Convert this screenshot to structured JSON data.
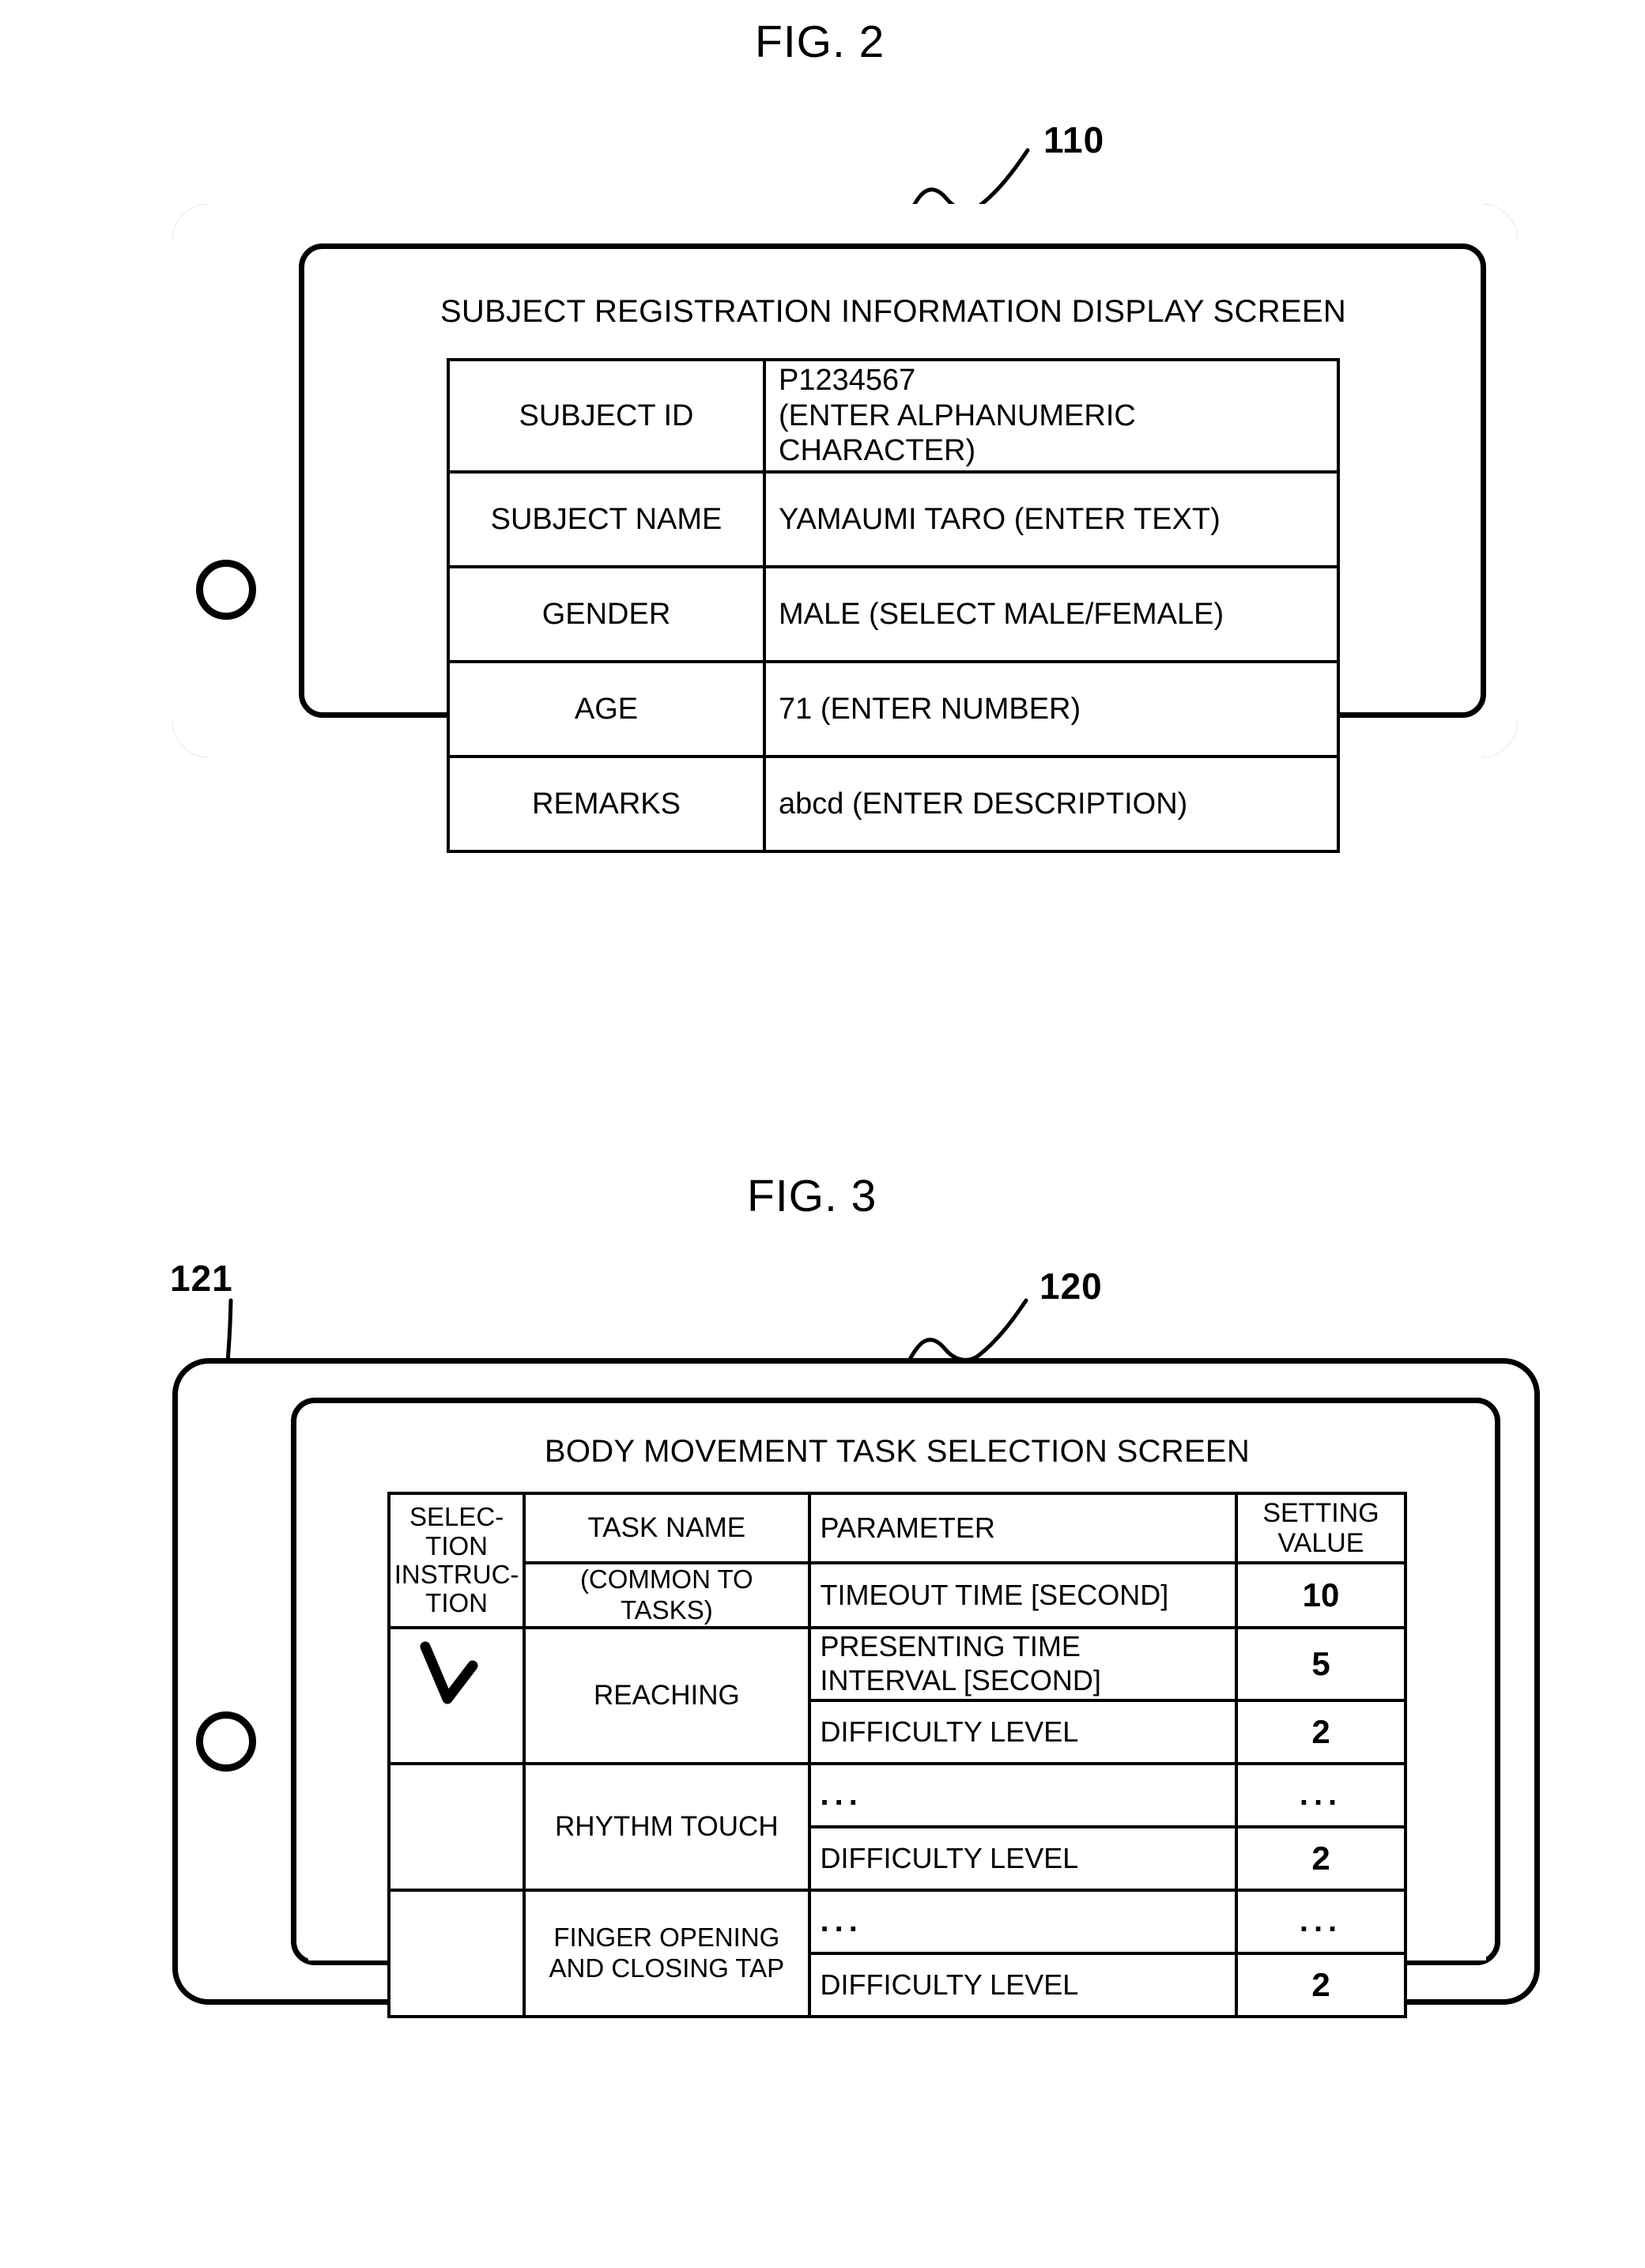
{
  "figures": [
    {
      "fig_label": "FIG. 2",
      "reference_numeral": "110",
      "screen_title": "SUBJECT REGISTRATION INFORMATION DISPLAY SCREEN",
      "table": {
        "rows": [
          {
            "label": "SUBJECT ID",
            "value_line1": "P1234567",
            "value_line2": "(ENTER ALPHANUMERIC CHARACTER)"
          },
          {
            "label": "SUBJECT NAME",
            "value_line1": "YAMAUMI TARO (ENTER TEXT)",
            "value_line2": ""
          },
          {
            "label": "GENDER",
            "value_line1": "MALE (SELECT MALE/FEMALE)",
            "value_line2": ""
          },
          {
            "label": "AGE",
            "value_line1": "71 (ENTER NUMBER)",
            "value_line2": ""
          },
          {
            "label": "REMARKS",
            "value_line1": "abcd (ENTER DESCRIPTION)",
            "value_line2": ""
          }
        ]
      }
    },
    {
      "fig_label": "FIG. 3",
      "reference_numeral": "120",
      "reference_numeral_detail": "121",
      "screen_title": "BODY MOVEMENT TASK SELECTION SCREEN",
      "table": {
        "headers": {
          "selection_line1": "SELEC-",
          "selection_line2": "TION",
          "selection_line3": "INSTRUC-",
          "selection_line4": "TION",
          "task_name": "TASK NAME",
          "parameter": "PARAMETER",
          "setting_value_line1": "SETTING",
          "setting_value_line2": "VALUE"
        },
        "selection_mark": "checkmark",
        "rows": [
          {
            "task": "(COMMON TO TASKS)",
            "param_line1": "TIMEOUT TIME [SECOND]",
            "param_line2": "",
            "value": "10"
          },
          {
            "task": "REACHING",
            "param_line1": "PRESENTING TIME",
            "param_line2": "INTERVAL [SECOND]",
            "value": "5"
          },
          {
            "task": "",
            "param_line1": "DIFFICULTY LEVEL",
            "param_line2": "",
            "value": "2"
          },
          {
            "task": "RHYTHM TOUCH",
            "param_line1": "...",
            "param_line2": "",
            "value": "..."
          },
          {
            "task": "",
            "param_line1": "DIFFICULTY LEVEL",
            "param_line2": "",
            "value": "2"
          },
          {
            "task": "FINGER OPENING AND CLOSING TAP",
            "task_line1": "FINGER OPENING",
            "task_line2": "AND CLOSING TAP",
            "param_line1": "...",
            "param_line2": "",
            "value": "..."
          },
          {
            "task": "",
            "param_line1": "DIFFICULTY LEVEL",
            "param_line2": "",
            "value": "2"
          }
        ]
      }
    }
  ]
}
